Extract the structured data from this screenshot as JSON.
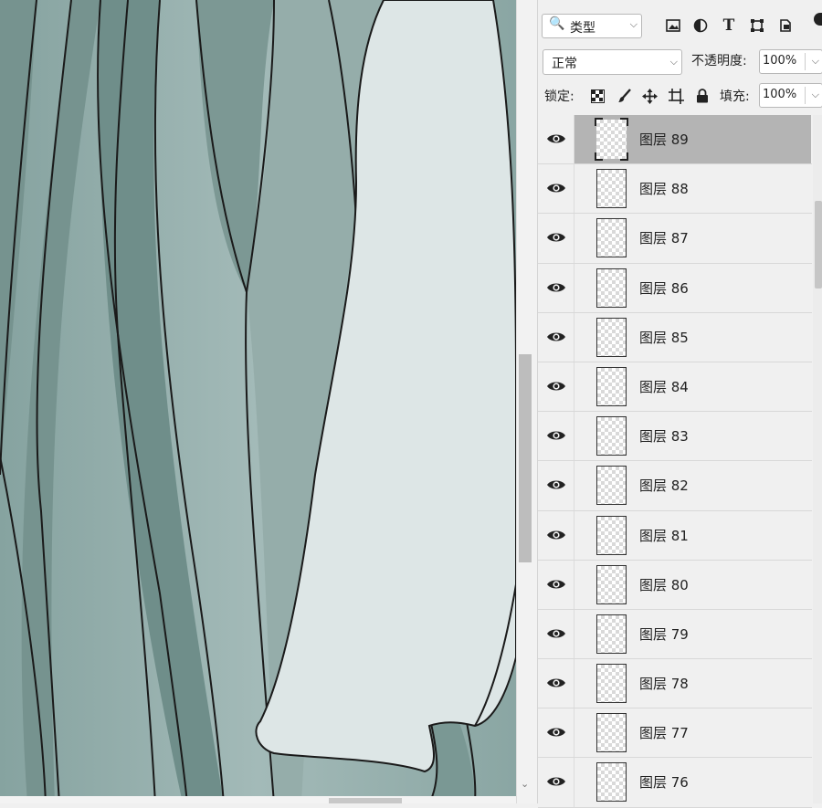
{
  "canvas": {
    "description_colors": {
      "dark": "#6e8f8b",
      "light": "#9db4b2",
      "cloth": "#dde6e6",
      "line": "#1a1a1a"
    }
  },
  "panel": {
    "filter": {
      "glyph": "🔍",
      "label": "类型"
    },
    "filter_icons": [
      "image-icon",
      "adjustment-icon",
      "type-icon",
      "shape-icon",
      "smart-object-icon"
    ],
    "blend_mode": "正常",
    "opacity_label": "不透明度:",
    "opacity_value": "100%",
    "lock_label": "锁定:",
    "fill_label": "填充:",
    "fill_value": "100%",
    "layers": [
      {
        "name": "图层 89",
        "selected": true
      },
      {
        "name": "图层 88"
      },
      {
        "name": "图层 87"
      },
      {
        "name": "图层 86"
      },
      {
        "name": "图层 85"
      },
      {
        "name": "图层 84"
      },
      {
        "name": "图层 83"
      },
      {
        "name": "图层 82"
      },
      {
        "name": "图层 81"
      },
      {
        "name": "图层 80"
      },
      {
        "name": "图层 79"
      },
      {
        "name": "图层 78"
      },
      {
        "name": "图层 77"
      },
      {
        "name": "图层 76"
      }
    ]
  }
}
